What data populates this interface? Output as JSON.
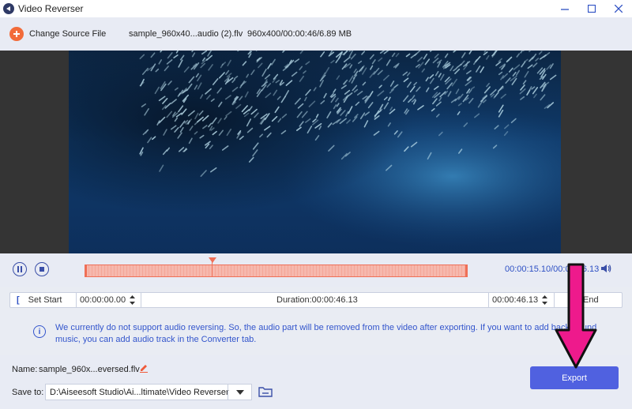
{
  "window": {
    "title": "Video Reverser",
    "controls": [
      "minimize-icon",
      "maximize-icon",
      "close-icon"
    ]
  },
  "toolbar": {
    "change_source_label": "Change Source File",
    "file_name": "sample_960x40...audio (2).flv",
    "file_meta": "960x400/00:00:46/6.89 MB"
  },
  "player": {
    "time_readout": "00:00:15.10/00:00:46.13",
    "volume_icon": "volume-icon",
    "playhead_fraction": 0.33
  },
  "range": {
    "set_start_label": "Set Start",
    "start_time": "00:00:00.00",
    "duration": "Duration:00:00:46.13",
    "end_time": "00:00:46.13",
    "set_end_label": "End"
  },
  "notice": {
    "text": "We currently do not support audio reversing. So, the audio part will be removed from the video after exporting. If you want to add background music, you can add audio track in the Converter tab."
  },
  "output": {
    "name_label": "Name:",
    "name_value": "sample_960x...eversed.flv",
    "save_label": "Save to:",
    "save_path": "D:\\Aiseesoft Studio\\Ai...ltimate\\Video Reverser",
    "export_label": "Export"
  },
  "colors": {
    "accent": "#5061e0",
    "timeline": "#f6b8ad",
    "timeline_border": "#ef6f57",
    "add_button": "#f26b3a",
    "annotation_arrow": "#ee1a8c"
  }
}
